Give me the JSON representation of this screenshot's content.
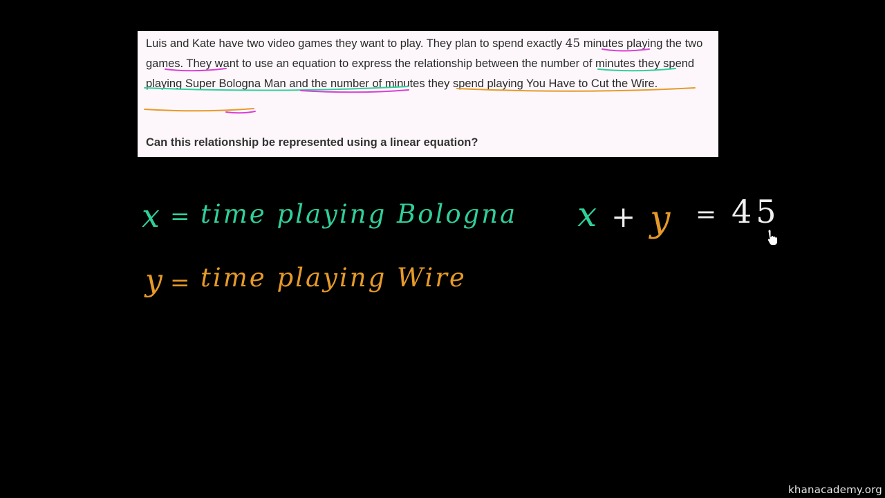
{
  "problem": {
    "seg1": "Luis and Kate have two video games they want to play. They plan to spend exactly ",
    "num": "45",
    "seg2": " minutes playing the two games. They want to use an equation to express the relationship between the number of minutes they spend playing Super Bologna Man and the number of minutes they spend playing You Have to Cut the Wire.",
    "question": "Can this relationship be represented using a linear equation?"
  },
  "board": {
    "x_def": {
      "var": "x",
      "eq": "=",
      "text": "time playing Bologna"
    },
    "y_def": {
      "var": "y",
      "eq": "=",
      "text": "time playing Wire"
    },
    "equation": {
      "x": "x",
      "plus": "+",
      "y": "y",
      "eq": "=",
      "rhs": "45"
    }
  },
  "watermark": "khanacademy.org",
  "colors": {
    "background": "#000000",
    "card_background": "#fdf7fb",
    "teal": "#2fcf9b",
    "orange": "#e69a28",
    "magenta": "#d93fd6",
    "white": "#f0f0f0"
  },
  "icons": {
    "cursor": "hand-pointer-icon"
  }
}
